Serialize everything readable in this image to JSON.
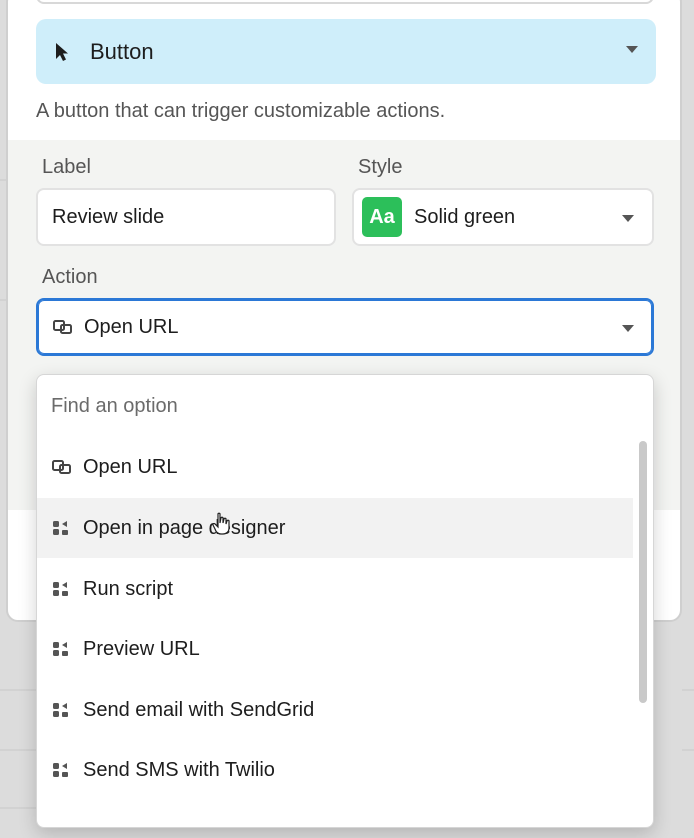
{
  "block_type": {
    "icon": "cursor-arrow-icon",
    "label": "Button",
    "description": "A button that can trigger customizable actions."
  },
  "label_field": {
    "label": "Label",
    "value": "Review slide"
  },
  "style_field": {
    "label": "Style",
    "badge": "Aa",
    "value": "Solid green",
    "badge_color": "#2cbf5a"
  },
  "action_field": {
    "label": "Action",
    "icon": "link-icon",
    "value": "Open URL",
    "focus_color": "#2b78d6"
  },
  "dropdown": {
    "search_placeholder": "Find an option",
    "options": [
      {
        "label": "Open URL",
        "icon": "link-icon"
      },
      {
        "label": "Open in page designer",
        "icon": "extension-icon"
      },
      {
        "label": "Run script",
        "icon": "extension-icon"
      },
      {
        "label": "Preview URL",
        "icon": "extension-icon"
      },
      {
        "label": "Send email with SendGrid",
        "icon": "extension-icon"
      },
      {
        "label": "Send SMS with Twilio",
        "icon": "extension-icon"
      }
    ]
  }
}
